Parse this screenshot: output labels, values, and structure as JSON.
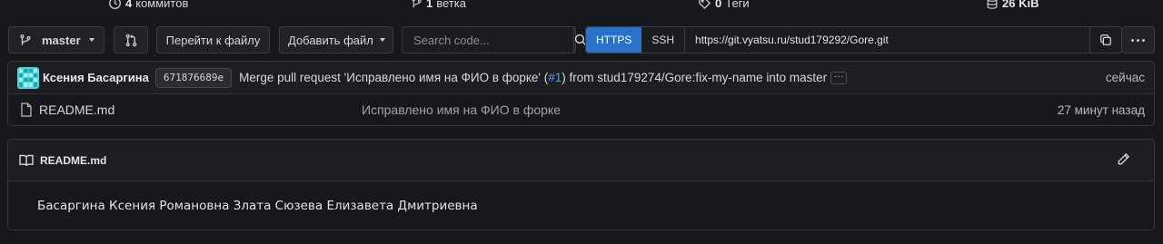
{
  "stats": {
    "commits": {
      "count": "4",
      "label": "коммитов",
      "icon": "history-icon"
    },
    "branches": {
      "count": "1",
      "label": "ветка",
      "icon": "branch-icon"
    },
    "tags": {
      "count": "0",
      "label": "Теги",
      "icon": "tag-icon"
    },
    "size": {
      "count": "26 KiB",
      "label": "",
      "icon": "database-icon"
    }
  },
  "toolbar": {
    "branch": "master",
    "goto_file": "Перейти к файлу",
    "add_file": "Добавить файл",
    "search_placeholder": "Search code...",
    "clone": {
      "https": "HTTPS",
      "ssh": "SSH",
      "url": "https://git.vyatsu.ru/stud179292/Gore.git",
      "active": "HTTPS"
    }
  },
  "latest_commit": {
    "author": "Ксения Басаргина",
    "sha": "671876689e",
    "message_before": "Merge pull request 'Исправлено имя на ФИО в форке' (",
    "pr_ref": "#1",
    "message_after": ") from stud179274/Gore:fix-my-name into master",
    "more": "···",
    "time": "сейчас"
  },
  "files": [
    {
      "name": "README.md",
      "message": "Исправлено имя на ФИО в форке",
      "time": "27 минут назад",
      "icon": "file-icon"
    }
  ],
  "readme": {
    "title": "README.md",
    "content": "Басаргина Ксения Романовна Злата Сюзева Елизавета Дмитриевна"
  },
  "colors": {
    "background": "#17181b",
    "accent": "#2a72c9",
    "link": "#5a9ee6",
    "border": "#33363b"
  }
}
